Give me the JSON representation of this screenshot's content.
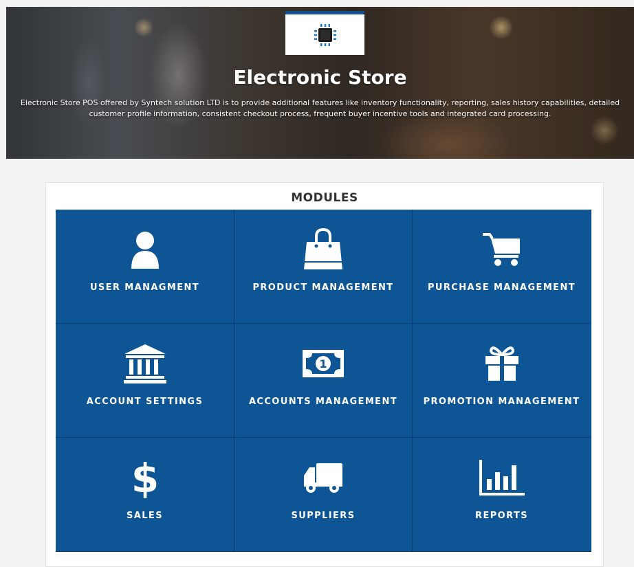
{
  "hero": {
    "title": "Electronic Store",
    "description": "Electronic Store POS offered by Syntech solution LTD is to provide additional features like inventory functionality, reporting, sales history capabilities, detailed customer profile information, consistent checkout process, frequent buyer incentive tools and integrated card processing.",
    "logo_icon": "chip-icon"
  },
  "modules": {
    "heading": "MODULES",
    "items": [
      {
        "label": "USER MANAGMENT",
        "icon": "user-icon"
      },
      {
        "label": "PRODUCT MANAGEMENT",
        "icon": "shopping-bag-icon"
      },
      {
        "label": "PURCHASE MANAGEMENT",
        "icon": "cart-icon"
      },
      {
        "label": "ACCOUNT SETTINGS",
        "icon": "bank-icon"
      },
      {
        "label": "ACCOUNTS MANAGEMENT",
        "icon": "money-icon"
      },
      {
        "label": "PROMOTION MANAGEMENT",
        "icon": "gift-icon"
      },
      {
        "label": "SALES",
        "icon": "dollar-icon"
      },
      {
        "label": "SUPPLIERS",
        "icon": "truck-icon"
      },
      {
        "label": "REPORTS",
        "icon": "bar-chart-icon"
      }
    ]
  },
  "colors": {
    "tile": "#0e5595",
    "logo_border": "#0f4f8e",
    "heading_text": "#333333"
  }
}
